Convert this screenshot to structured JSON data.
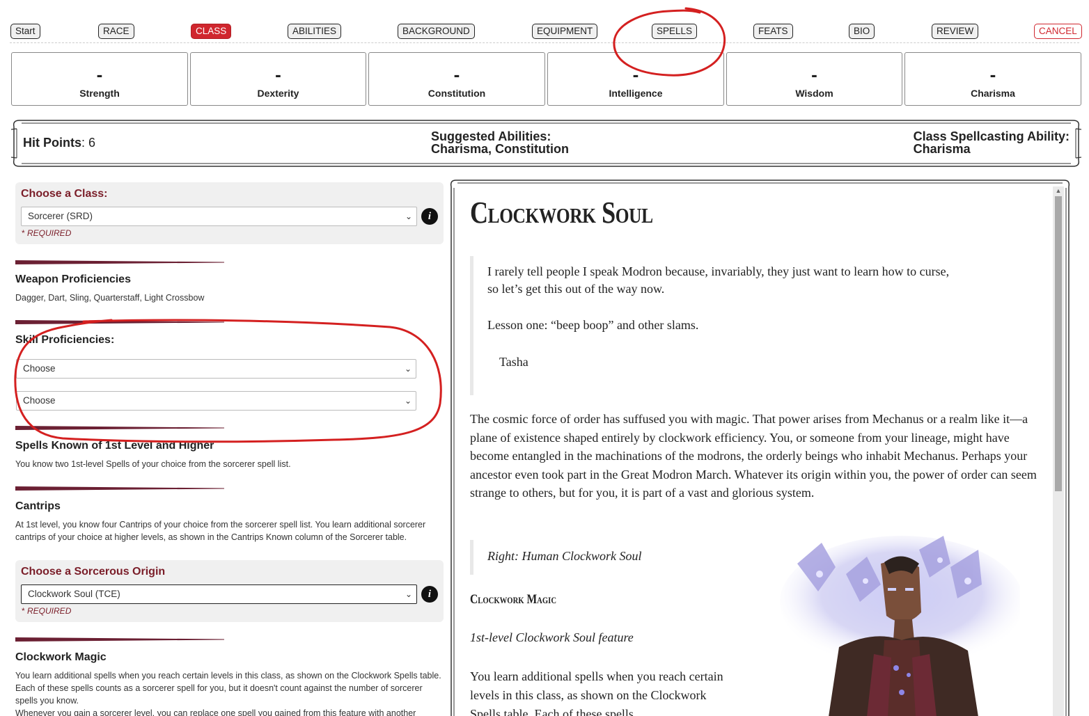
{
  "nav": {
    "start": "Start",
    "race": "RACE",
    "class": "CLASS",
    "abilities": "ABILITIES",
    "background": "BACKGROUND",
    "equipment": "EQUIPMENT",
    "spells": "SPELLS",
    "feats": "FEATS",
    "bio": "BIO",
    "review": "REVIEW",
    "cancel": "CANCEL",
    "active": "CLASS",
    "accent_color": "#d0262e"
  },
  "abilities": [
    {
      "value": "-",
      "label": "Strength"
    },
    {
      "value": "-",
      "label": "Dexterity"
    },
    {
      "value": "-",
      "label": "Constitution"
    },
    {
      "value": "-",
      "label": "Intelligence"
    },
    {
      "value": "-",
      "label": "Wisdom"
    },
    {
      "value": "-",
      "label": "Charisma"
    }
  ],
  "summary": {
    "hp_label": "Hit Points",
    "hp_value": ": 6",
    "suggested_label": "Suggested Abilities:",
    "suggested_value": "Charisma, Constitution",
    "spellcasting_label": "Class Spellcasting Ability:",
    "spellcasting_value": "Charisma"
  },
  "left": {
    "class_box": {
      "title": "Choose a Class:",
      "selected": "Sorcerer (SRD)",
      "required": "REQUIRED",
      "required_star": "*"
    },
    "weapon": {
      "title": "Weapon Proficiencies",
      "text": "Dagger, Dart, Sling, Quarterstaff, Light Crossbow"
    },
    "skills": {
      "title": "Skill Proficiencies:",
      "select1": "Choose",
      "select2": "Choose"
    },
    "spells_known": {
      "title": "Spells Known of 1st Level and Higher",
      "text": "You know two 1st-level Spells of your choice from the sorcerer spell list."
    },
    "cantrips": {
      "title": "Cantrips",
      "text": "At 1st level, you know four Cantrips of your choice from the sorcerer spell list. You learn additional sorcerer cantrips of your choice at higher levels, as shown in the Cantrips Known column of the Sorcerer table."
    },
    "origin_box": {
      "title": "Choose a Sorcerous Origin",
      "selected": "Clockwork Soul (TCE)",
      "required": "REQUIRED",
      "required_star": "*"
    },
    "clockwork_magic": {
      "title": "Clockwork Magic",
      "text1": "You learn additional spells when you reach certain levels in this class, as shown on the Clockwork Spells table. Each of these spells counts as a sorcerer spell for you, but it doesn't count against the number of sorcerer spells you know.",
      "text2": "Whenever you gain a sorcerer level, you can replace one spell you gained from this feature with another"
    }
  },
  "right": {
    "heading": "Clockwork Soul",
    "quote_line1": "I rarely tell people I speak Modron because, invariably, they just want to learn how to curse,",
    "quote_line2": "so let’s get this out of the way now.",
    "quote_line3": "Lesson one: “beep boop” and other slams.",
    "quote_attr": "Tasha",
    "para1": "The cosmic force of order has suffused you with magic. That power arises from Mechanus or a realm like it—a plane of existence shaped entirely by clockwork efficiency. You, or someone from your lineage, might have become entangled in the machinations of the modrons, the orderly beings who inhabit Mechanus. Perhaps your ancestor even took part in the Great Modron March. Whatever its origin within you, the power of order can seem strange to others, but for you, it is part of a vast and glorious system.",
    "caption": "Right: Human Clockwork Soul",
    "subhead": "Clockwork Magic",
    "feature_line": "1st-level Clockwork Soul feature",
    "para2": "You learn additional spells when you reach certain levels in this class, as shown on the Clockwork Spells table. Each of these spells"
  },
  "icons": {
    "info": "i",
    "chevron": "⌄"
  }
}
